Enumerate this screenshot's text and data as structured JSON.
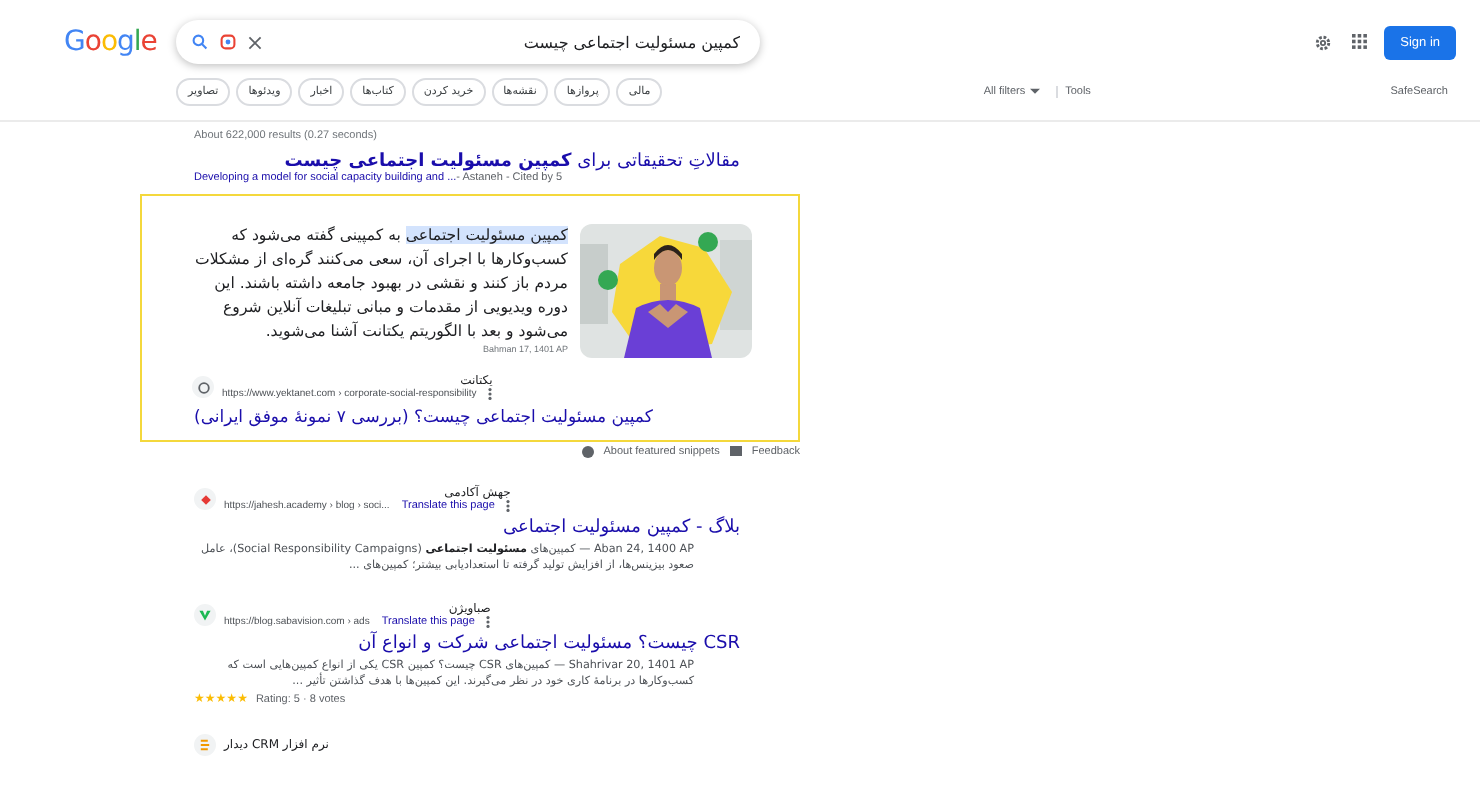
{
  "header": {
    "logo": "Google",
    "query": "کمپین مسئولیت اجتماعی چیست",
    "sign_in": "Sign in"
  },
  "chips": [
    "مالی",
    "پروازها",
    "نقشه‌ها",
    "خرید کردن",
    "کتاب‌ها",
    "اخبار",
    "ویدئوها",
    "تصاویر"
  ],
  "filters": {
    "all_filters": "All filters",
    "tools": "Tools",
    "safesearch": "SafeSearch"
  },
  "stats": "About 622,000 results (0.27 seconds)",
  "scholar": {
    "title": "مقالاتِ تحقیقاتی برای **کمپین مسئولیت اجتماعی چیست**",
    "link": "Developing a model for social capacity building and ...",
    "meta": " - Astaneh - Cited by 5"
  },
  "featured": {
    "text": "**کمپین مسئولیت اجتماعی** به کمپینی گفته می‌شود که کسب‌وکارها با اجرای آن، سعی می‌کنند گره‌ای از مشکلات مردم باز کنند و نقشی در بهبود جامعه داشته باشند. این دوره ویدیویی از مقدمات و مبانی تبلیغات آنلاین شروع می‌شود و بعد با الگوریتم یکتانت آشنا می‌شوید.",
    "date": "Bahman 17, 1401 AP",
    "site": "یکتانت",
    "url": "https://www.yektanet.com › corporate-social-responsibility",
    "title": "کمپین مسئولیت اجتماعی چیست؟ (بررسی ۷ نمونهٔ موفق ایرانی)",
    "about": "About featured snippets",
    "feedback": "Feedback"
  },
  "results": [
    {
      "kind": "red",
      "site": "جهش آکادمی",
      "url": "https://jahesh.academy › blog › soci...",
      "translate": "Translate this page",
      "title": "بلاگ - کمپین مسئولیت اجتماعی",
      "snippet": "Aban 24, 1400 AP — کمپین‌های **مسئولیت اجتماعی** (Social Responsibility Campaigns)، عامل صعود بیزینس‌ها، از افزایش تولید گرفته تا استعدادیابی بیشتر؛ کمپین‌های ..."
    },
    {
      "kind": "green",
      "site": "صباویژن",
      "url": "https://blog.sabavision.com › ads",
      "translate": "Translate this page",
      "title": "CSR چیست؟ مسئولیت اجتماعی شرکت و انواع آن",
      "snippet": "Shahrivar 20, 1401 AP — کمپین‌های CSR چیست؟ کمپین CSR یکی از انواع کمپین‌هایی است که کسب‌وکارها در برنامهٔ کاری خود در نظر می‌گیرند. این کمپین‌ها با هدف گذاشتن تأثیر ...",
      "stars": 5,
      "rating": "Rating: 5 · 8 votes"
    },
    {
      "kind": "orange",
      "site": "نرم افزار CRM دیدار"
    }
  ]
}
